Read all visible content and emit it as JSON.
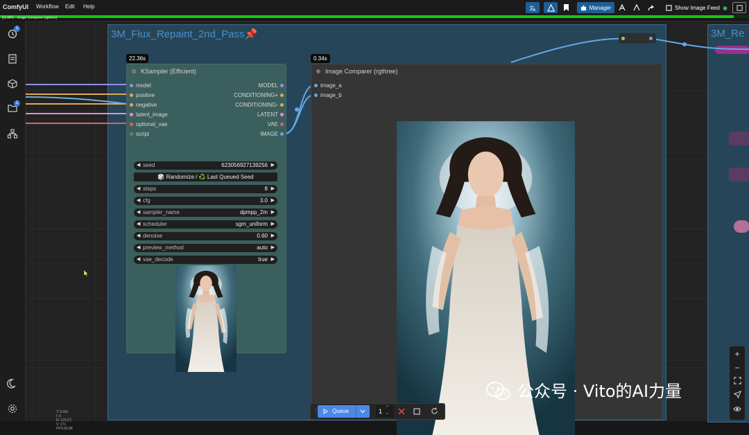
{
  "menu": {
    "brand": "ComfyUI",
    "items": [
      "Workflow",
      "Edit",
      "Help"
    ]
  },
  "toolbar": {
    "manager_label": "Manager",
    "image_feed_label": "Show Image Feed",
    "accent_color": "#1e5e96"
  },
  "progress": {
    "text": "[1] 98% - Image Comparer (rgthree)",
    "value": 0.98,
    "color": "#14c814"
  },
  "sidebar": {
    "queue_badge": "1",
    "models_badge": "2"
  },
  "group": {
    "title": "3M_Flux_Repaint_2nd_Pass",
    "title_icon": "📌",
    "color": "#284a60"
  },
  "group2": {
    "title": "3M_Re"
  },
  "ksampler": {
    "time": "22.36s",
    "title": "KSampler (Efficient)",
    "inputs": [
      "model",
      "positive",
      "negative",
      "latent_image",
      "optional_vae",
      "script"
    ],
    "outputs": [
      "MODEL",
      "CONDITIONING+",
      "CONDITIONING-",
      "LATENT",
      "VAE",
      "IMAGE"
    ],
    "seed": {
      "label": "seed",
      "value": "623056927139256"
    },
    "randomize_label": "🎲 Randomize / ♻️ Last Queued Seed",
    "widgets": [
      {
        "label": "steps",
        "value": "8"
      },
      {
        "label": "cfg",
        "value": "3.0"
      },
      {
        "label": "sampler_name",
        "value": "dpmpp_2m"
      },
      {
        "label": "scheduler",
        "value": "sgm_uniform"
      },
      {
        "label": "denoise",
        "value": "0.60"
      },
      {
        "label": "preview_method",
        "value": "auto"
      },
      {
        "label": "vae_decode",
        "value": "true"
      }
    ]
  },
  "comparer": {
    "time": "0.34s",
    "title": "Image Comparer (rgthree)",
    "inputs": [
      "image_a",
      "image_b"
    ]
  },
  "queue": {
    "label": "Queue",
    "batch_count": "1"
  },
  "stats": {
    "lines": [
      "T: 0.00s",
      "I: 0",
      "N: 124 [7]",
      "V: 271",
      "FPS:56.88"
    ]
  },
  "watermark": {
    "text": "公众号 · Vito的AI力量"
  }
}
